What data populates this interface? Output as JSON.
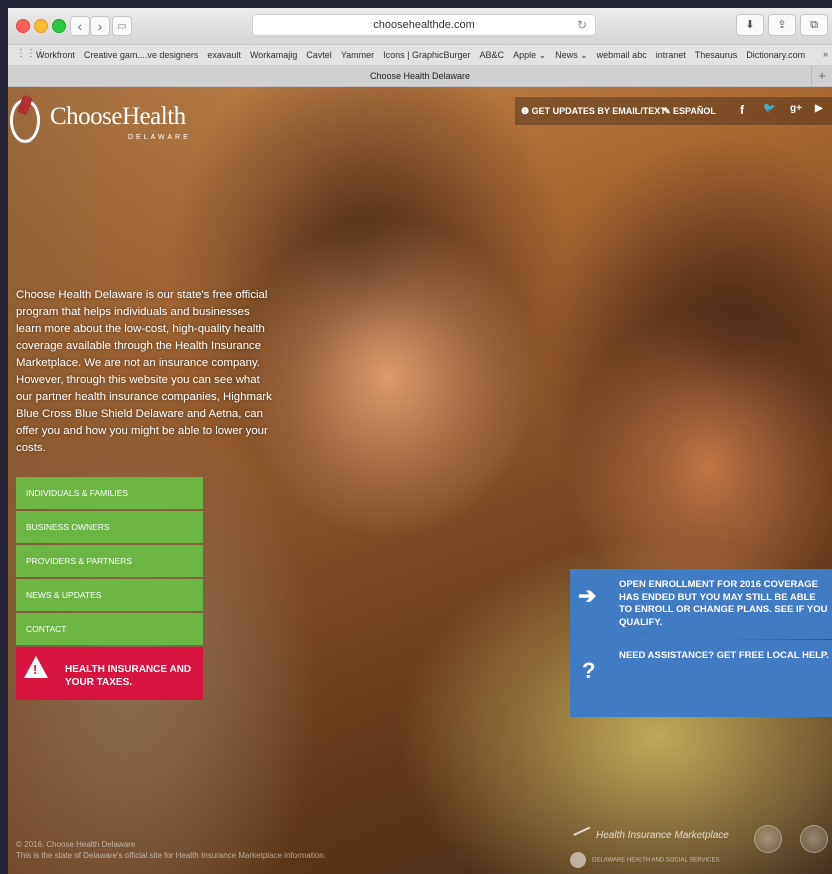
{
  "browser": {
    "url": "choosehealthde.com",
    "reload_icon": "↻",
    "tab_title": "Choose Health Delaware",
    "bookmarks": [
      "Workfront",
      "Creative gam....ve designers",
      "exavault",
      "Workamajig",
      "Cavtel",
      "Yammer",
      "Icons | GraphicBurger",
      "AB&C",
      "Apple ⌄",
      "News ⌄",
      "webmail abc",
      "intranet",
      "Thesaurus",
      "Dictionary.com"
    ],
    "more": "»"
  },
  "site": {
    "logo_name": "ChooseHealth",
    "logo_state": "DELAWARE",
    "topnav": {
      "updates": "❶ GET UPDATES BY EMAIL/TEXT",
      "espanol": "✎ ESPAÑOL",
      "social": [
        "f",
        "🐦",
        "g+",
        "▶"
      ]
    },
    "intro": "Choose Health Delaware is our state's free official program that helps individuals and businesses learn more about the low-cost, high-quality health coverage available through the Health Insurance Marketplace. We are not an insurance company. However, through this website you can see what our partner health insurance companies, Highmark Blue Cross Blue Shield Delaware and Aetna, can offer you and how you might be able to lower your costs.",
    "menu": [
      "INDIVIDUALS & FAMILIES",
      "BUSINESS OWNERS",
      "PROVIDERS & PARTNERS",
      "NEWS & UPDATES",
      "CONTACT"
    ],
    "tax_button": "HEALTH INSURANCE AND YOUR TAXES.",
    "cta1": "OPEN ENROLLMENT FOR 2016 COVERAGE HAS ENDED BUT YOU MAY STILL BE ABLE TO ENROLL OR CHANGE PLANS. SEE IF YOU QUALIFY.",
    "cta2": "NEED ASSISTANCE? GET FREE LOCAL HELP.",
    "footer_line1": "© 2016. Choose Health Delaware",
    "footer_line2": "This is the state of Delaware's official site for Health Insurance Marketplace information.",
    "marketplace_logo": "Health Insurance Marketplace",
    "dhss_logo": "DELAWARE HEALTH AND SOCIAL SERVICES"
  },
  "colors": {
    "menu_green": "#6cb744",
    "tax_red": "#d7143f",
    "cta_blue": "#3f7cc4"
  }
}
